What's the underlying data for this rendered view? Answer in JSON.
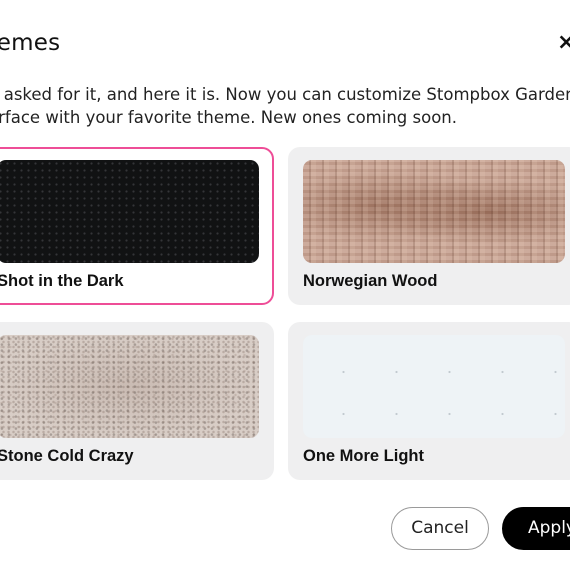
{
  "dialog": {
    "title": "hemes",
    "close_label": "×",
    "description_line1": "u asked for it, and here it is. Now you can customize Stompbox Garden",
    "description_line2": "erface with your favorite theme. New ones coming soon."
  },
  "themes": [
    {
      "label": "Shot in the Dark",
      "selected": true,
      "swatch_color": "#111213"
    },
    {
      "label": "Norwegian Wood",
      "selected": false,
      "swatch_color": "#c7a393"
    },
    {
      "label": "Stone Cold Crazy",
      "selected": false,
      "swatch_color": "#d8cdc6"
    },
    {
      "label": "One More Light",
      "selected": false,
      "swatch_color": "#eef3f6"
    }
  ],
  "colors": {
    "selected_border": "#ee4d97",
    "card_bg": "#efeff0",
    "primary_button": "#000000"
  },
  "buttons": {
    "cancel_label": "Cancel",
    "apply_label": "Apply"
  }
}
